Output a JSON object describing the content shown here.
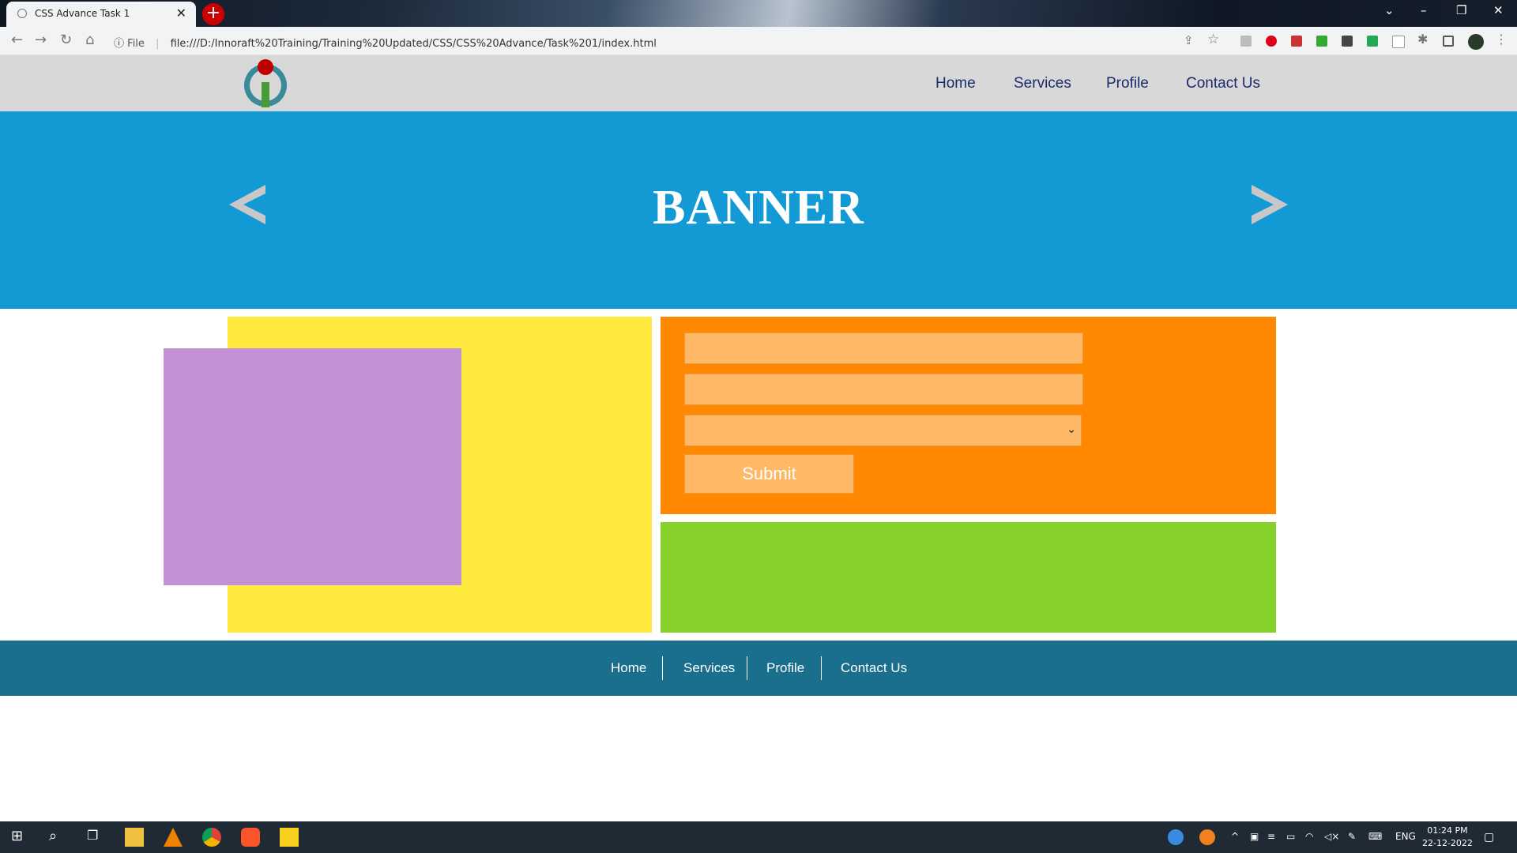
{
  "browser": {
    "tab_title": "CSS Advance Task 1",
    "tab_close": "✕",
    "new_tab": "+",
    "address_label": "File",
    "url": "file:///D:/Innoraft%20Training/Training%20Updated/CSS/CSS%20Advance/Task%201/index.html"
  },
  "header": {
    "nav": [
      "Home",
      "Services",
      "Profile",
      "Contact Us"
    ]
  },
  "banner": {
    "title": "BANNER"
  },
  "form": {
    "submit_label": "Submit"
  },
  "footer": {
    "nav": [
      "Home",
      "Services",
      "Profile",
      "Contact Us"
    ]
  },
  "taskbar": {
    "lang": "ENG",
    "time": "01:24 PM",
    "date": "22-12-2022"
  },
  "colors": {
    "header_bg": "#d8d8d8",
    "banner_bg": "#1399d3",
    "yellow": "#ffe93c",
    "purple": "#c391d6",
    "orange": "#ff8800",
    "green": "#86d12b",
    "footer_bg": "#1a6f8c",
    "nav_text": "#1a2a6c"
  }
}
